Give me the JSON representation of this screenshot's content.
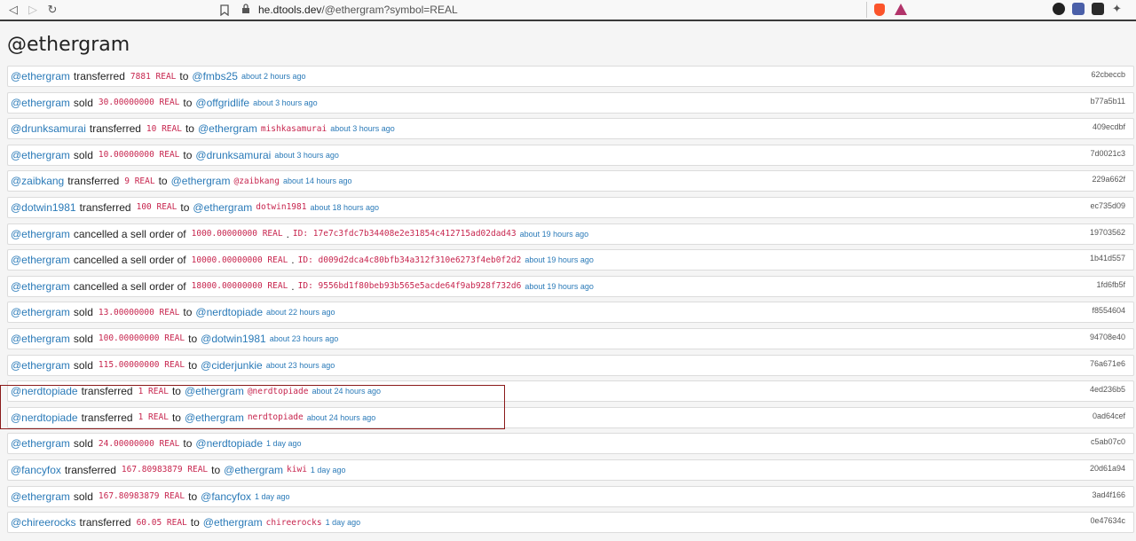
{
  "browser": {
    "host": "he.dtools.dev",
    "path": "/@ethergram?symbol=REAL"
  },
  "page_title": "@ethergram",
  "rows": [
    {
      "user": "@ethergram",
      "action": "transferred",
      "amount": "7881 REAL",
      "mid": "to",
      "target": "@fmbs25",
      "memo": "",
      "time": "about 2 hours ago",
      "hash": "62cbeccb"
    },
    {
      "user": "@ethergram",
      "action": "sold",
      "amount": "30.00000000 REAL",
      "mid": "to",
      "target": "@offgridlife",
      "memo": "",
      "time": "about 3 hours ago",
      "hash": "b77a5b11"
    },
    {
      "user": "@drunksamurai",
      "action": "transferred",
      "amount": "10 REAL",
      "mid": "to",
      "target": "@ethergram",
      "memo": "mishkasamurai",
      "time": "about 3 hours ago",
      "hash": "409ecdbf"
    },
    {
      "user": "@ethergram",
      "action": "sold",
      "amount": "10.00000000 REAL",
      "mid": "to",
      "target": "@drunksamurai",
      "memo": "",
      "time": "about 3 hours ago",
      "hash": "7d0021c3"
    },
    {
      "user": "@zaibkang",
      "action": "transferred",
      "amount": "9 REAL",
      "mid": "to",
      "target": "@ethergram",
      "memo": "@zaibkang",
      "time": "about 14 hours ago",
      "hash": "229a662f"
    },
    {
      "user": "@dotwin1981",
      "action": "transferred",
      "amount": "100 REAL",
      "mid": "to",
      "target": "@ethergram",
      "memo": "dotwin1981",
      "time": "about 18 hours ago",
      "hash": "ec735d09"
    },
    {
      "user": "@ethergram",
      "action": "cancelled a sell order of",
      "amount": "1000.00000000 REAL",
      "mid": ".",
      "target": "",
      "memo": "ID: 17e7c3fdc7b34408e2e31854c412715ad02dad43",
      "time": "about 19 hours ago",
      "hash": "19703562"
    },
    {
      "user": "@ethergram",
      "action": "cancelled a sell order of",
      "amount": "10000.00000000 REAL",
      "mid": ".",
      "target": "",
      "memo": "ID: d009d2dca4c80bfb34a312f310e6273f4eb0f2d2",
      "time": "about 19 hours ago",
      "hash": "1b41d557"
    },
    {
      "user": "@ethergram",
      "action": "cancelled a sell order of",
      "amount": "18000.00000000 REAL",
      "mid": ".",
      "target": "",
      "memo": "ID: 9556bd1f80beb93b565e5acde64f9ab928f732d6",
      "time": "about 19 hours ago",
      "hash": "1fd6fb5f"
    },
    {
      "user": "@ethergram",
      "action": "sold",
      "amount": "13.00000000 REAL",
      "mid": "to",
      "target": "@nerdtopiade",
      "memo": "",
      "time": "about 22 hours ago",
      "hash": "f8554604"
    },
    {
      "user": "@ethergram",
      "action": "sold",
      "amount": "100.00000000 REAL",
      "mid": "to",
      "target": "@dotwin1981",
      "memo": "",
      "time": "about 23 hours ago",
      "hash": "94708e40"
    },
    {
      "user": "@ethergram",
      "action": "sold",
      "amount": "115.00000000 REAL",
      "mid": "to",
      "target": "@ciderjunkie",
      "memo": "",
      "time": "about 23 hours ago",
      "hash": "76a671e6"
    },
    {
      "user": "@nerdtopiade",
      "action": "transferred",
      "amount": "1 REAL",
      "mid": "to",
      "target": "@ethergram",
      "memo": "@nerdtopiade",
      "time": "about 24 hours ago",
      "hash": "4ed236b5"
    },
    {
      "user": "@nerdtopiade",
      "action": "transferred",
      "amount": "1 REAL",
      "mid": "to",
      "target": "@ethergram",
      "memo": "nerdtopiade",
      "time": "about 24 hours ago",
      "hash": "0ad64cef"
    },
    {
      "user": "@ethergram",
      "action": "sold",
      "amount": "24.00000000 REAL",
      "mid": "to",
      "target": "@nerdtopiade",
      "memo": "",
      "time": "1 day ago",
      "hash": "c5ab07c0"
    },
    {
      "user": "@fancyfox",
      "action": "transferred",
      "amount": "167.80983879 REAL",
      "mid": "to",
      "target": "@ethergram",
      "memo": "kiwi",
      "time": "1 day ago",
      "hash": "20d61a94"
    },
    {
      "user": "@ethergram",
      "action": "sold",
      "amount": "167.80983879 REAL",
      "mid": "to",
      "target": "@fancyfox",
      "memo": "",
      "time": "1 day ago",
      "hash": "3ad4f166"
    },
    {
      "user": "@chireerocks",
      "action": "transferred",
      "amount": "60.05 REAL",
      "mid": "to",
      "target": "@ethergram",
      "memo": "chireerocks",
      "time": "1 day ago",
      "hash": "0e47634c"
    }
  ]
}
